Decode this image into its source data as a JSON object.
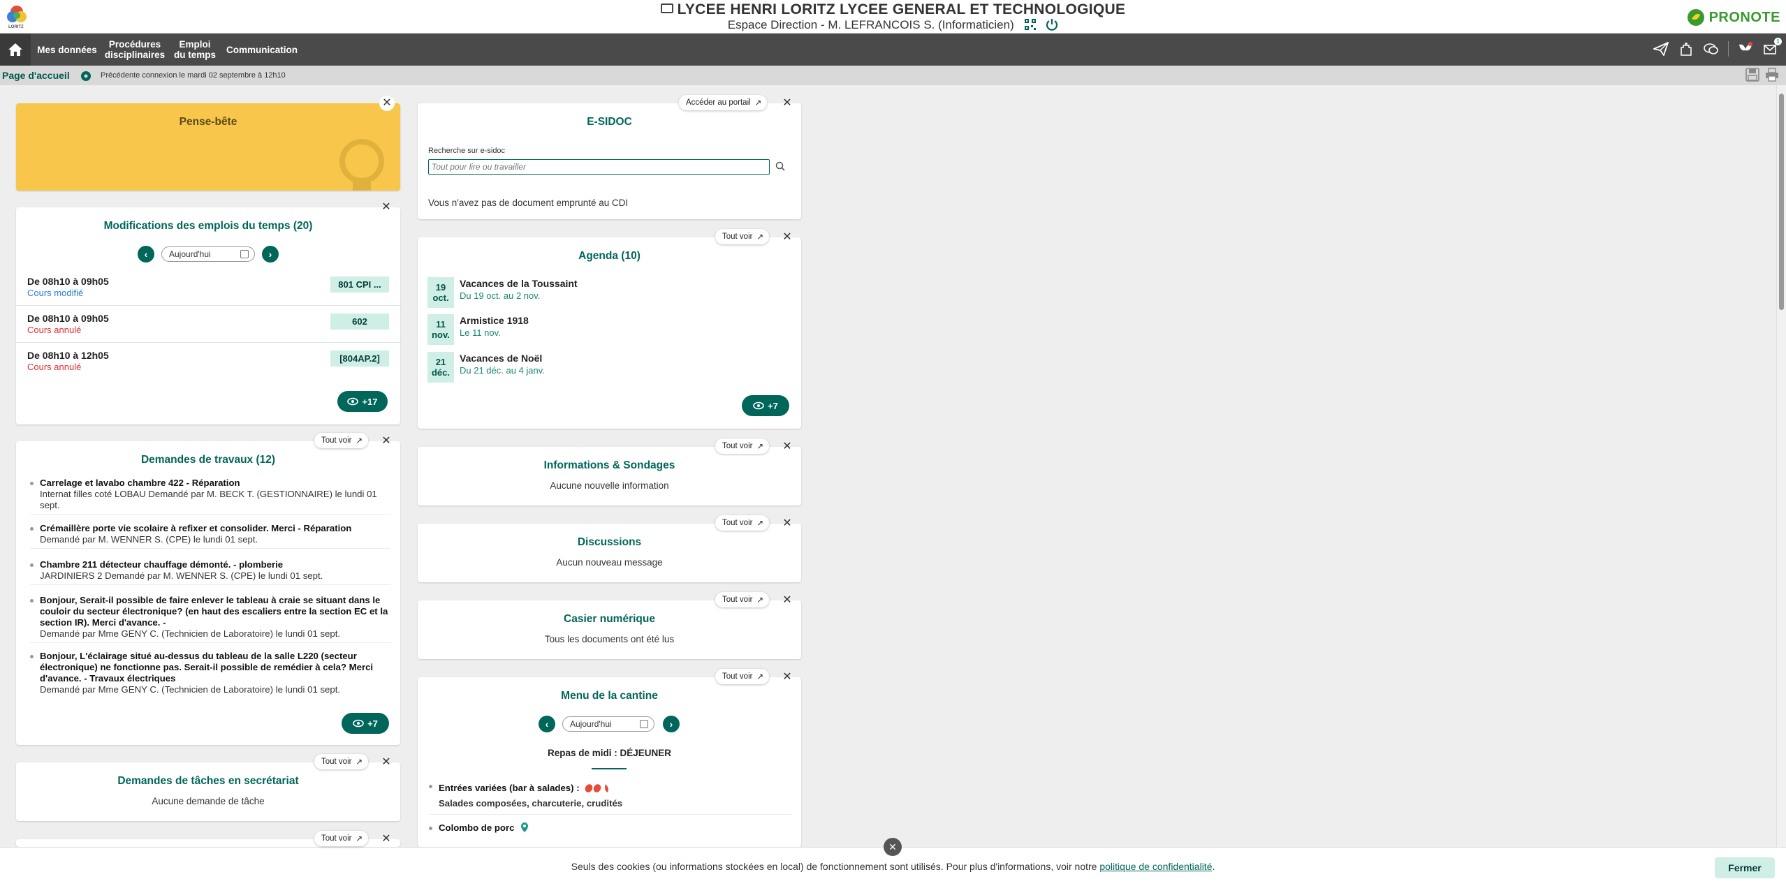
{
  "header": {
    "school_name": "LYCEE HENRI LORITZ LYCEE GENERAL ET TECHNOLOGIQUE",
    "space": "Espace Direction - M. LEFRANCOIS S. (Informaticien)",
    "logo_caption": "LORITZ",
    "brand": "PRONOTE",
    "brand_color": "#3a9a2d"
  },
  "nav": {
    "home_icon": "home-icon",
    "items": [
      "Mes données",
      "Procédures disciplinaires",
      "Emploi du temps",
      "Communication"
    ],
    "item_lines": [
      [
        "Mes données"
      ],
      [
        "Procédures",
        "disciplinaires"
      ],
      [
        "Emploi",
        "du temps"
      ],
      [
        "Communication"
      ]
    ],
    "right_icons": [
      "send-icon",
      "castle-icon",
      "chat-icon",
      "bug-icon",
      "messages-icon"
    ],
    "messages_badge": "1"
  },
  "breadcrumb": {
    "title": "Page d'accueil",
    "last_login": "Précédente connexion le mardi 02 septembre à 12h10"
  },
  "common": {
    "tout_voir": "Tout voir",
    "today": "Aujourd'hui"
  },
  "pense_bete": {
    "title": "Pense-bête",
    "color": "#f7c64b"
  },
  "emplois": {
    "title": "Modifications des emplois du temps (20)",
    "rows": [
      {
        "time": "De 08h10 à 09h05",
        "status": "Cours modifié",
        "tag": "801 CPI ...",
        "status_color": "#2a7fd4"
      },
      {
        "time": "De 08h10 à 09h05",
        "status": "Cours annulé",
        "tag": "602",
        "status_color": "#e03030"
      },
      {
        "time": "De 08h10 à 12h05",
        "status": "Cours annulé",
        "tag": "[804AP.2]",
        "status_color": "#e03030"
      }
    ],
    "more": "+17"
  },
  "travaux": {
    "title": "Demandes de travaux (12)",
    "items": [
      {
        "title": "Carrelage et lavabo chambre 422 - Réparation",
        "detail": "Internat filles coté LOBAU Demandé par M. BECK T. (GESTIONNAIRE) le lundi 01 sept."
      },
      {
        "title": "Crémaillère porte vie scolaire à refixer et consolider. Merci - Réparation",
        "detail": "Demandé par M. WENNER S. (CPE) le lundi 01 sept."
      },
      {
        "title": "Chambre 211 détecteur chauffage démonté. - plomberie",
        "detail": "JARDINIERS 2 Demandé par M. WENNER S. (CPE) le lundi 01 sept."
      },
      {
        "title": "Bonjour, Serait-il possible de faire enlever le tableau à craie se situant dans le couloir du secteur électronique? (en haut des escaliers entre la section EC et la section IR). Merci d'avance. -",
        "detail": "Demandé par Mme GENY C. (Technicien de Laboratoire) le lundi 01 sept."
      },
      {
        "title": "Bonjour, L'éclairage situé au-dessus du tableau de la salle L220 (secteur électronique) ne fonctionne pas. Serait-il possible de remédier à cela? Merci d'avance. - Travaux électriques",
        "detail": "Demandé par Mme GENY C. (Technicien de Laboratoire) le lundi 01 sept."
      }
    ],
    "more": "+7"
  },
  "taches": {
    "title": "Demandes de tâches en secrétariat",
    "empty": "Aucune demande de tâche"
  },
  "esidoc": {
    "title": "E-SIDOC",
    "portal": "Accéder au portail",
    "search_label": "Recherche sur e-sidoc",
    "search_placeholder": "Tout pour lire ou travailler",
    "empty": "Vous n'avez pas de document emprunté au CDI"
  },
  "agenda": {
    "title": "Agenda (10)",
    "items": [
      {
        "day": "19",
        "month": "oct.",
        "title": "Vacances de la Toussaint",
        "range": "Du 19 oct. au 2 nov."
      },
      {
        "day": "11",
        "month": "nov.",
        "title": "Armistice 1918",
        "range": "Le 11 nov."
      },
      {
        "day": "21",
        "month": "déc.",
        "title": "Vacances de Noël",
        "range": "Du 21 déc. au 4 janv."
      }
    ],
    "more": "+7"
  },
  "infos": {
    "title": "Informations & Sondages",
    "empty": "Aucune nouvelle information"
  },
  "discussions": {
    "title": "Discussions",
    "empty": "Aucun nouveau message"
  },
  "casier": {
    "title": "Casier numérique",
    "empty": "Tous les documents ont été lus"
  },
  "cantine": {
    "title": "Menu de la cantine",
    "meal": "Repas de midi : DÉJEUNER",
    "items": [
      {
        "title": "Entrées variées (bar à salades) :",
        "detail": "Salades composées, charcuterie, crudités"
      },
      {
        "title": "Colombo de porc",
        "detail": ""
      }
    ]
  },
  "cookie": {
    "text": "Seuls des cookies (ou informations stockées en local) de fonctionnement sont utilisés. Pour plus d'informations, voir notre",
    "link": "politique de confidentialité",
    "end": ".",
    "close": "Fermer"
  },
  "colors": {
    "accent": "#00665a",
    "nav_bg": "#4a4a4a",
    "tag_bg": "#cfeee6"
  }
}
